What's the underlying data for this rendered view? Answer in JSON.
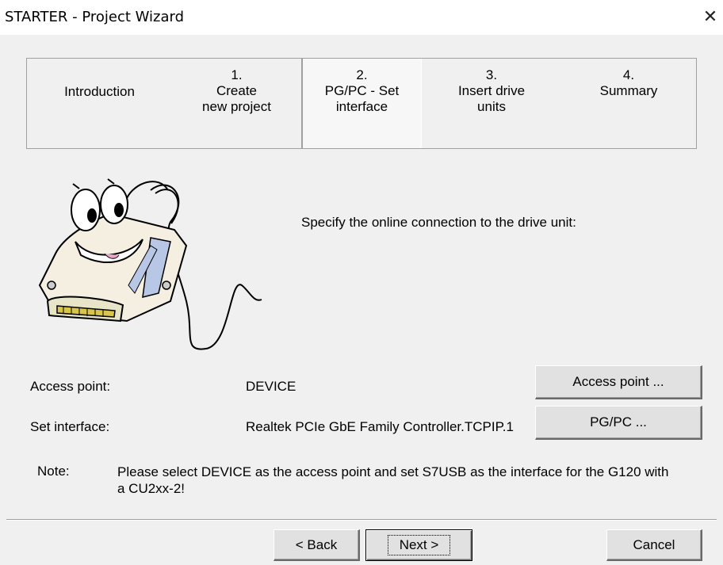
{
  "window": {
    "title": "STARTER - Project Wizard",
    "close_glyph": "✕"
  },
  "steps": [
    {
      "num": "",
      "label": "Introduction"
    },
    {
      "num": "1.",
      "label": "Create\nnew project"
    },
    {
      "num": "2.",
      "label": "PG/PC - Set\ninterface"
    },
    {
      "num": "3.",
      "label": "Insert drive\nunits"
    },
    {
      "num": "4.",
      "label": "Summary"
    }
  ],
  "active_step": "2. PG/PC - Set interface",
  "main": {
    "instruction": "Specify the online connection to the drive unit:",
    "access_point_label": "Access point:",
    "access_point_value": "DEVICE",
    "access_point_button": "Access point ...",
    "interface_label": "Set interface:",
    "interface_value": "Realtek PCIe GbE Family Controller.TCPIP.1",
    "interface_button": "PG/PC ...",
    "note_label": "Note:",
    "note_text": "Please select DEVICE as the access point and set S7USB as the interface for the G120 with a CU2xx-2!"
  },
  "footer": {
    "back_label": "< Back",
    "next_label": "Next >",
    "cancel_label": "Cancel"
  },
  "icons": {
    "mascot": "cable-connector-mascot-icon",
    "close": "close-icon"
  }
}
